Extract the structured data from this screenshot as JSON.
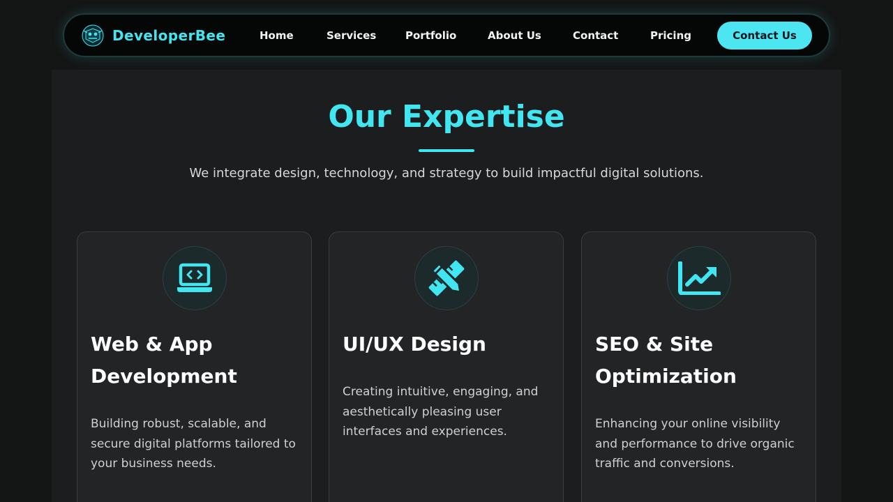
{
  "brand": {
    "name": "DeveloperBee",
    "logo_icon": "bee-logo-icon"
  },
  "nav": {
    "links": [
      "Home",
      "Services",
      "Portfolio",
      "About Us",
      "Contact",
      "Pricing"
    ],
    "cta_label": "Contact Us"
  },
  "expertise": {
    "title": "Our Expertise",
    "subtitle": "We integrate design, technology, and strategy to build impactful digital solutions.",
    "cards": [
      {
        "icon": "laptop-code-icon",
        "title": "Web & App Development",
        "description": "Building robust, scalable, and secure digital platforms tailored to your business needs."
      },
      {
        "icon": "design-pencil-ruler-icon",
        "title": "UI/UX Design",
        "description": "Creating intuitive, engaging, and aesthetically pleasing user interfaces and experiences."
      },
      {
        "icon": "chart-line-up-icon",
        "title": "SEO & Site Optimization",
        "description": "Enhancing your online visibility and performance to drive organic traffic and conversions."
      }
    ]
  },
  "colors": {
    "accent": "#41e6f0",
    "background": "#141515",
    "section": "#1c1d1e",
    "card": "#222426"
  }
}
